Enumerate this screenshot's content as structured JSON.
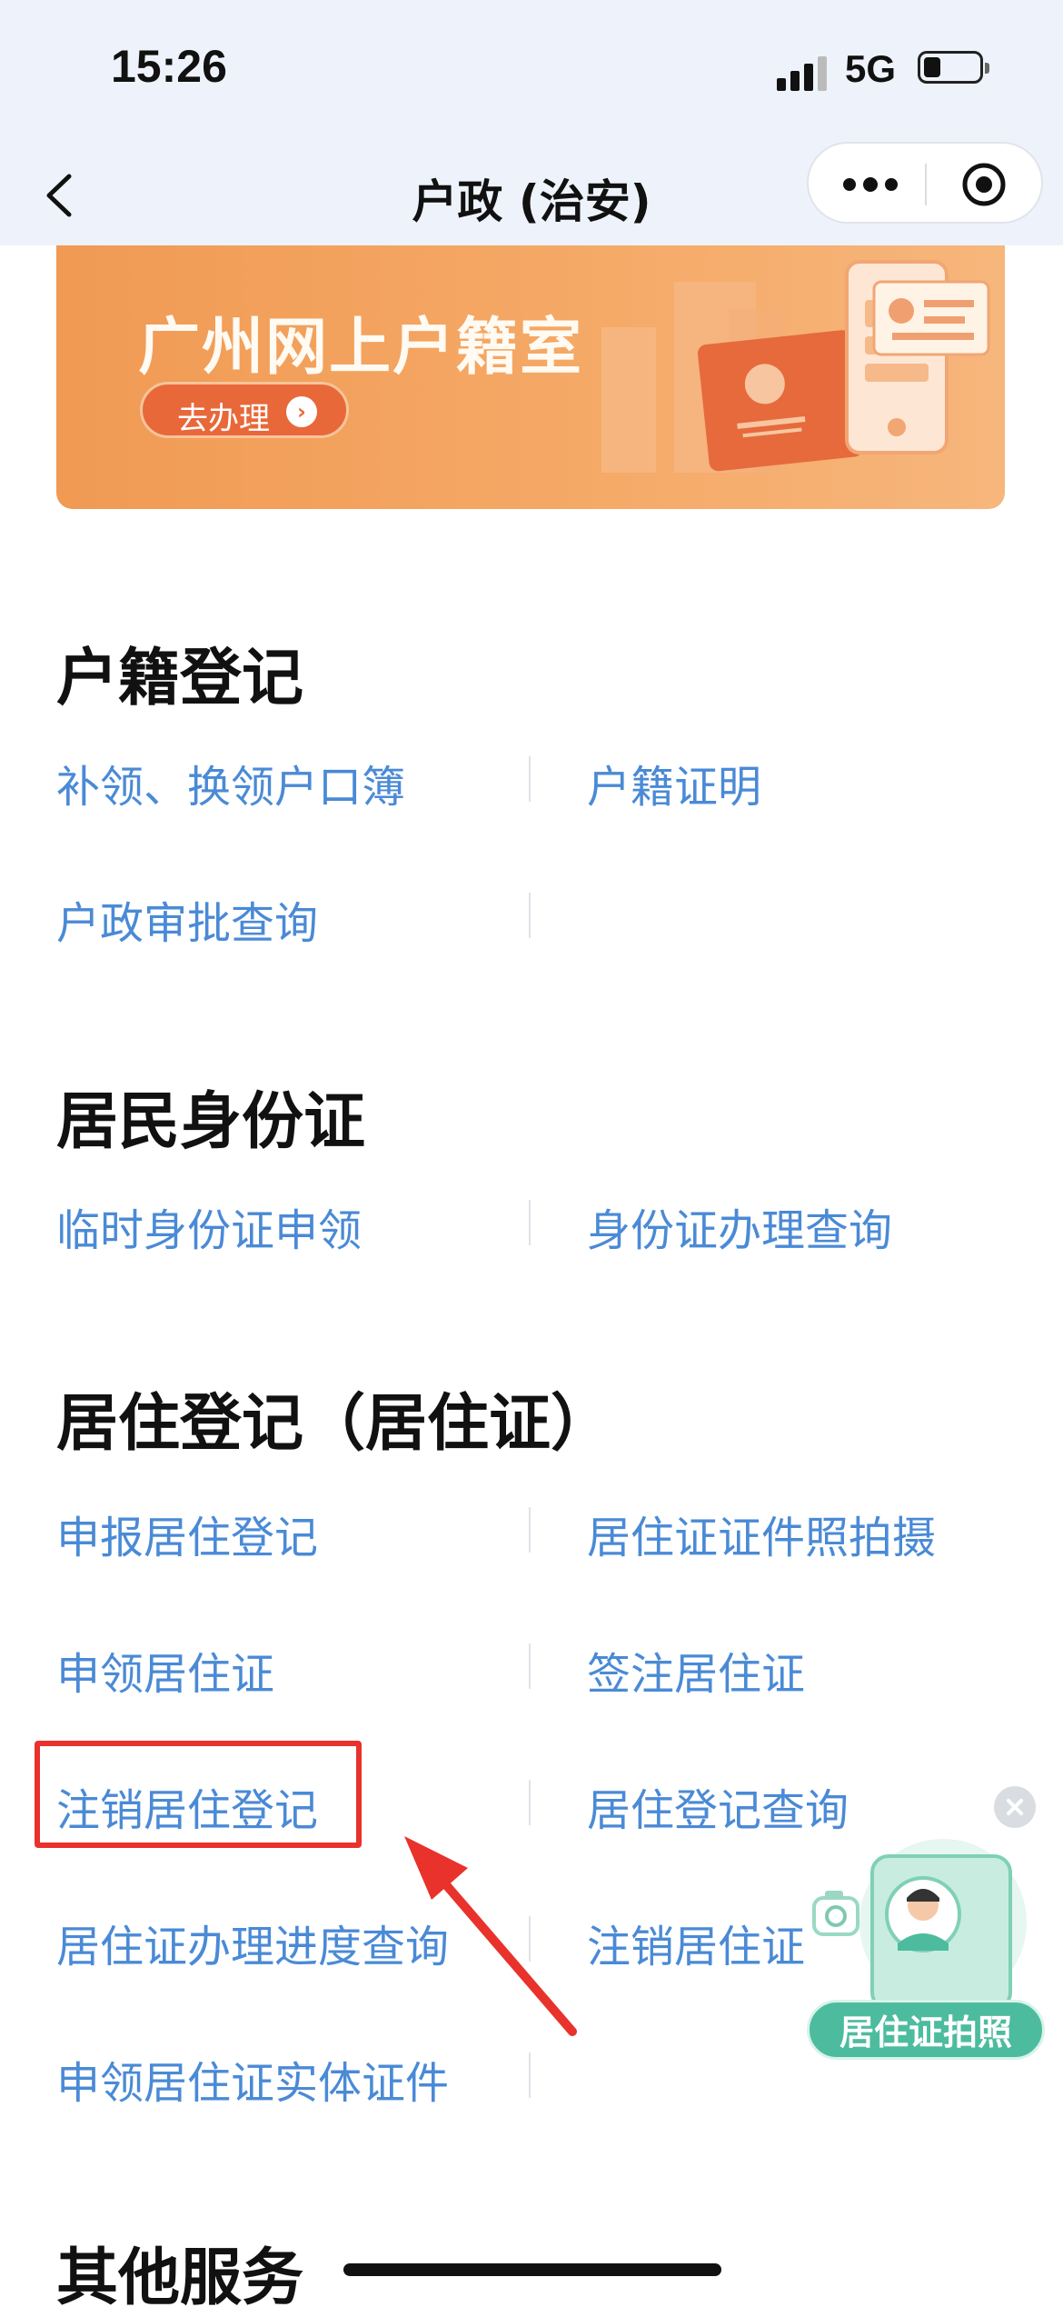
{
  "status_bar": {
    "time": "15:26",
    "network": "5G"
  },
  "nav": {
    "title": "户政 (治安)"
  },
  "banner": {
    "title": "广州网上户籍室",
    "button_label": "去办理"
  },
  "sections": [
    {
      "title": "户籍登记",
      "items": [
        "补领、换领户口簿",
        "户籍证明",
        "户政审批查询"
      ]
    },
    {
      "title": "居民身份证",
      "items": [
        "临时身份证申领",
        "身份证办理查询"
      ]
    },
    {
      "title": "居住登记（居住证）",
      "items": [
        "申报居住登记",
        "居住证证件照拍摄",
        "申领居住证",
        "签注居住证",
        "注销居住登记",
        "居住登记查询",
        "居住证办理进度查询",
        "注销居住证",
        "申领居住证实体证件"
      ]
    },
    {
      "title": "其他服务"
    }
  ],
  "float_widget": {
    "label": "居住证拍照"
  },
  "colors": {
    "link": "#4a8ad6",
    "highlight": "#e8322b",
    "banner": "#f5a966",
    "widget": "#4dbc9e"
  }
}
